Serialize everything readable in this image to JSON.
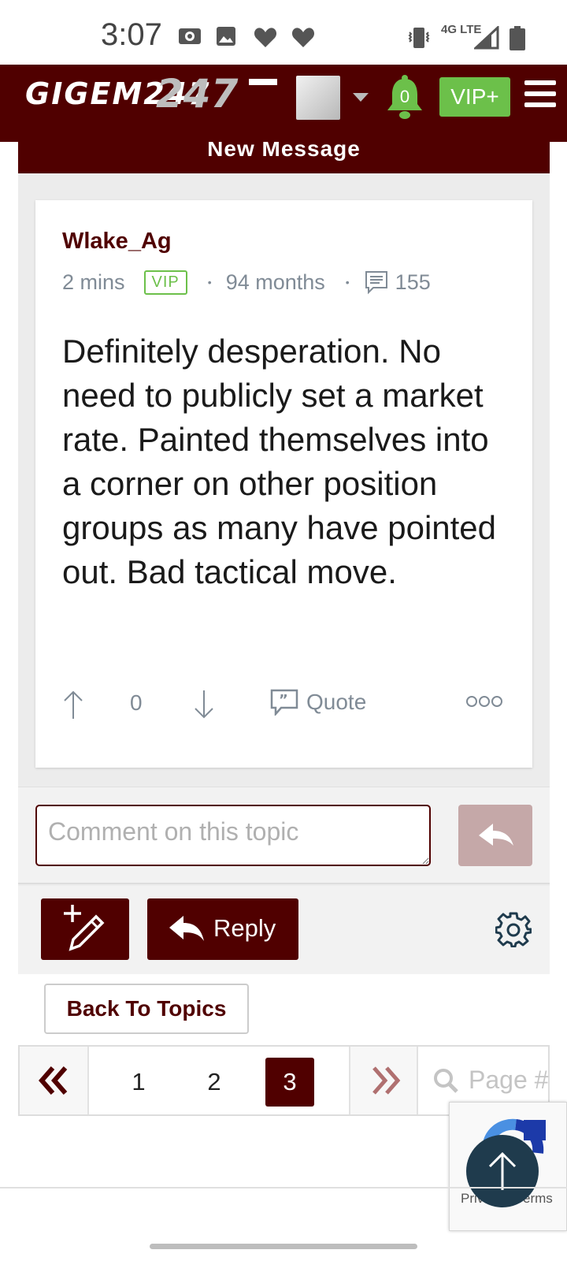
{
  "status_bar": {
    "time": "3:07",
    "network": "4G LTE"
  },
  "header": {
    "logo_text": "GIGEM247",
    "notification_count": "0",
    "vip_label": "VIP+"
  },
  "banner": {
    "title": "New Message"
  },
  "post": {
    "author": "Wlake_Ag",
    "time_ago": "2 mins",
    "badge": "VIP",
    "membership": "94 months",
    "post_count": "155",
    "body": "Definitely desperation. No need to publicly set a market rate. Painted themselves into a corner on other position groups as many have pointed out. Bad tactical move.",
    "vote_count": "0",
    "quote_label": "Quote"
  },
  "comment": {
    "placeholder": "Comment on this topic"
  },
  "actions": {
    "reply_label": "Reply",
    "back_label": "Back To Topics"
  },
  "pagination": {
    "pages": [
      "1",
      "2",
      "3"
    ],
    "current": "3",
    "search_placeholder": "Page #"
  },
  "recaptcha": {
    "text": "Privacy - Terms"
  },
  "colors": {
    "brand": "#500000",
    "accent_green": "#6cc04a",
    "meta_gray": "#808b96"
  }
}
